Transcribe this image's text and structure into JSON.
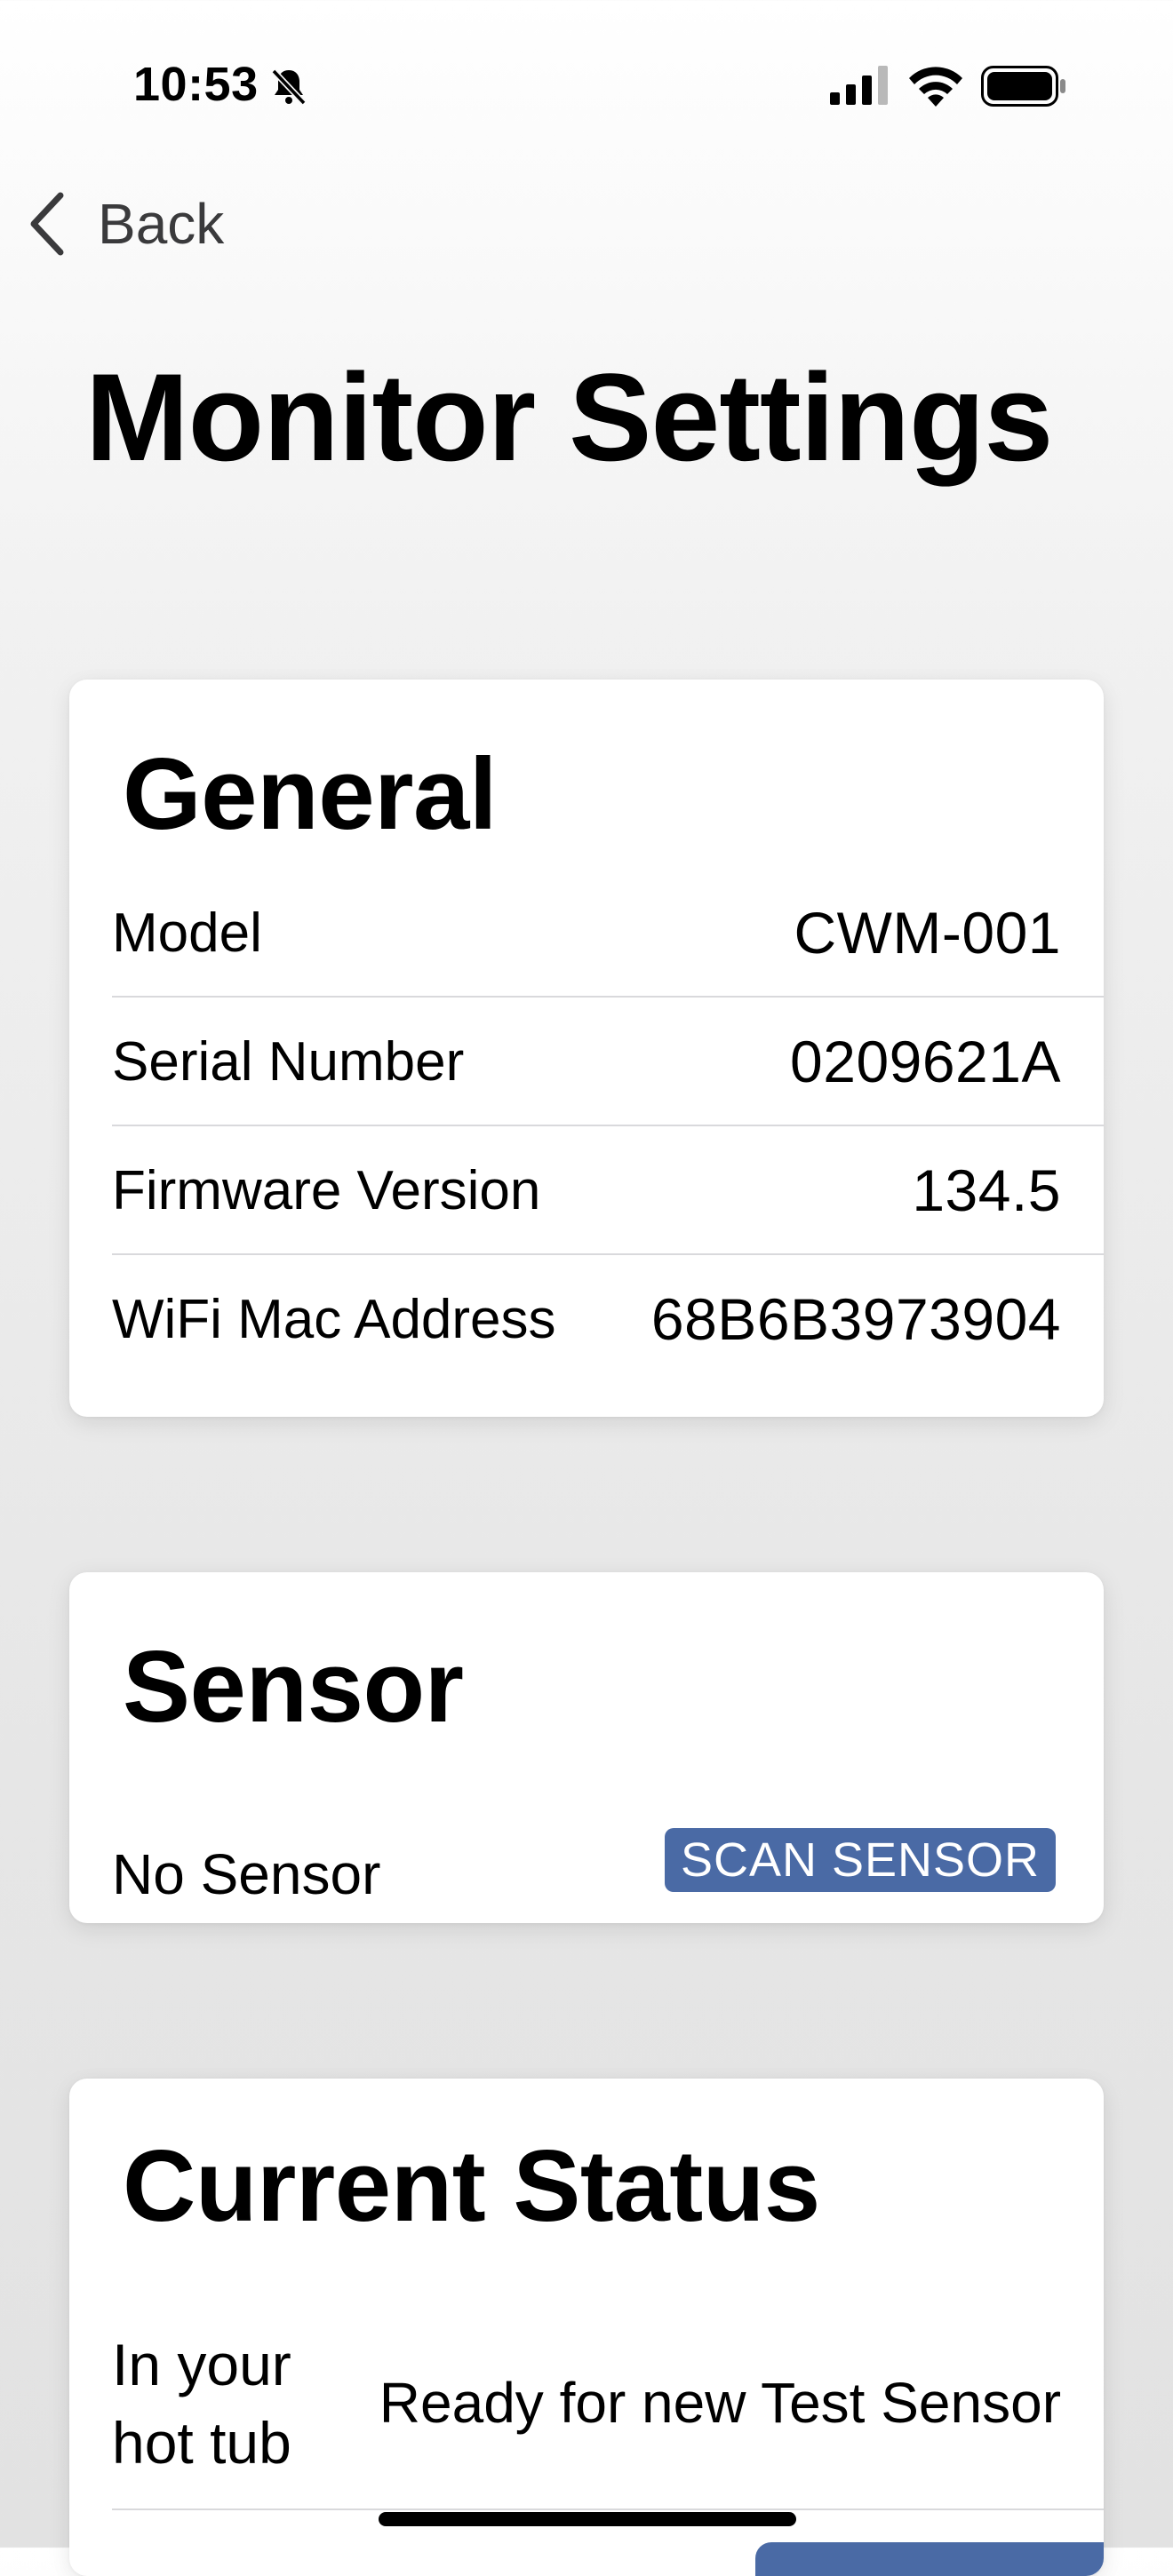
{
  "status_bar": {
    "time": "10:53",
    "icons": [
      "bell-slash-icon",
      "signal-icon",
      "wifi-icon",
      "battery-icon"
    ]
  },
  "nav": {
    "back_label": "Back",
    "back_icon": "chevron-left-icon"
  },
  "page": {
    "title": "Monitor Settings"
  },
  "general": {
    "title": "General",
    "rows": [
      {
        "label": "Model",
        "value": "CWM-001"
      },
      {
        "label": "Serial Number",
        "value": "0209621A"
      },
      {
        "label": "Firmware Version",
        "value": "134.5"
      },
      {
        "label": "WiFi Mac Address",
        "value": "68B6B3973904"
      }
    ]
  },
  "sensor": {
    "title": "Sensor",
    "status_text": "No Sensor",
    "scan_button_label": "SCAN SENSOR"
  },
  "current_status": {
    "title": "Current Status",
    "location_label": "In your hot tub",
    "location_value": "Ready for new Test Sensor"
  },
  "colors": {
    "accent_button": "#4a6aa5",
    "divider": "#d9d9dc",
    "card_background": "#ffffff",
    "back_text": "#3a3a3c"
  }
}
